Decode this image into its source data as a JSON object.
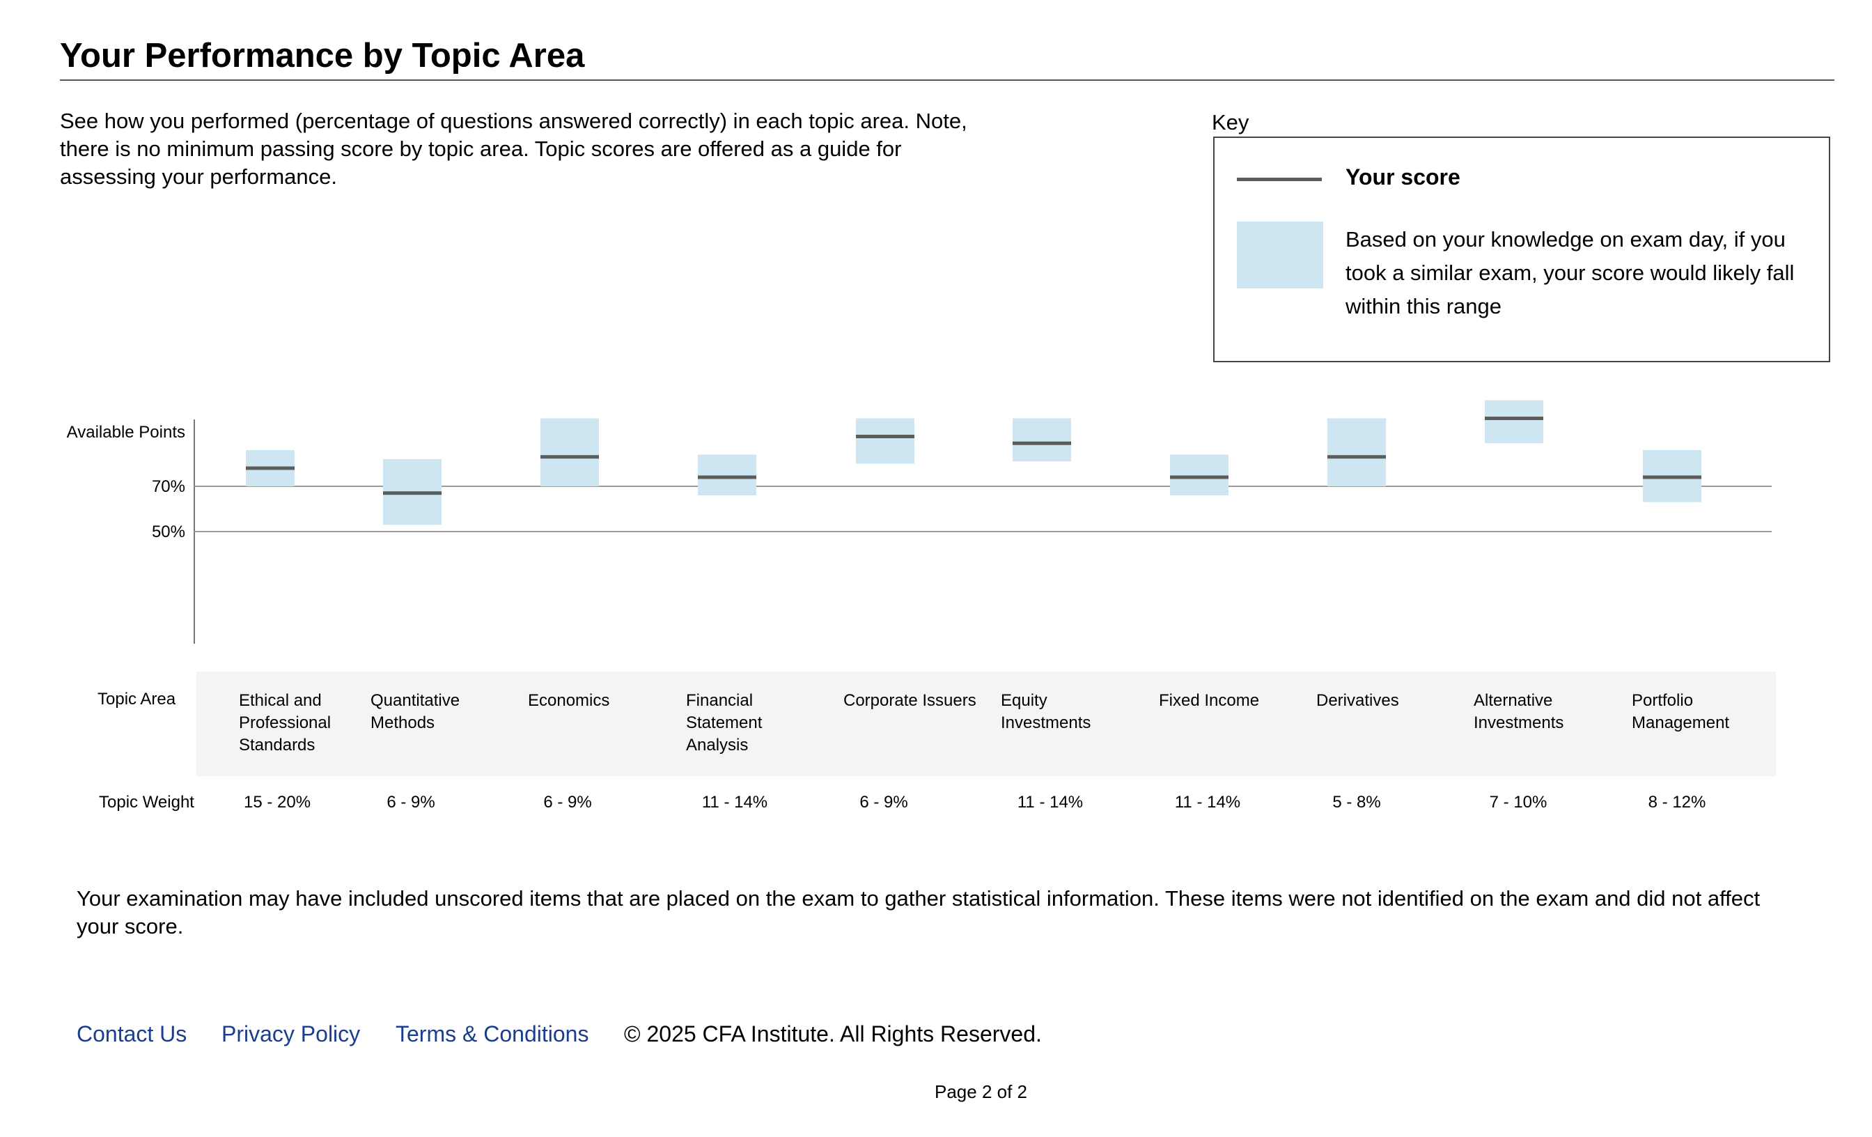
{
  "header": {
    "title": "Your Performance by Topic Area",
    "intro": "See how you performed (percentage of questions answered correctly) in each topic area. Note, there is no minimum passing score by topic area. Topic scores are offered as a guide for assessing your performance."
  },
  "key": {
    "label": "Key",
    "score_label": "Your score",
    "range_label": "Based on your knowledge on exam day, if you took a similar exam, your score would likely fall within this range",
    "colors": {
      "score_line": "#5c5c5c",
      "range_fill": "#cde6f2"
    }
  },
  "chart_data": {
    "type": "range",
    "y_axis_label": "Available Points",
    "reference_lines": [
      {
        "label": "70%",
        "value": 70
      },
      {
        "label": "50%",
        "value": 50
      }
    ],
    "ylim": [
      0,
      100
    ],
    "topics": [
      {
        "name": "Ethical and Professional Standards",
        "weight": "15 - 20%",
        "score": 78,
        "low": 70,
        "high": 86
      },
      {
        "name": "Quantitative Methods",
        "weight": "6 - 9%",
        "score": 67,
        "low": 53,
        "high": 82
      },
      {
        "name": "Economics",
        "weight": "6 - 9%",
        "score": 83,
        "low": 70,
        "high": 100
      },
      {
        "name": "Financial Statement Analysis",
        "weight": "11 - 14%",
        "score": 74,
        "low": 66,
        "high": 84
      },
      {
        "name": "Corporate Issuers",
        "weight": "6 - 9%",
        "score": 92,
        "low": 80,
        "high": 100
      },
      {
        "name": "Equity Investments",
        "weight": "11 - 14%",
        "score": 89,
        "low": 81,
        "high": 100
      },
      {
        "name": "Fixed Income",
        "weight": "11 - 14%",
        "score": 74,
        "low": 66,
        "high": 84
      },
      {
        "name": "Derivatives",
        "weight": "5 - 8%",
        "score": 83,
        "low": 70,
        "high": 100
      },
      {
        "name": "Alternative Investments",
        "weight": "7 - 10%",
        "score": 100,
        "low": 89,
        "high": 108
      },
      {
        "name": "Portfolio Management",
        "weight": "8 - 12%",
        "score": 74,
        "low": 63,
        "high": 86
      }
    ]
  },
  "table": {
    "topic_area_label": "Topic Area",
    "topic_weight_label": "Topic Weight"
  },
  "notice": "Your examination may have included unscored items that are placed on the exam to gather statistical information. These items were not identified on the exam and did not affect your score.",
  "footer": {
    "links": [
      "Contact Us",
      "Privacy Policy",
      "Terms & Conditions"
    ],
    "copyright": "© 2025 CFA Institute. All Rights Reserved.",
    "page": "Page 2 of 2"
  }
}
